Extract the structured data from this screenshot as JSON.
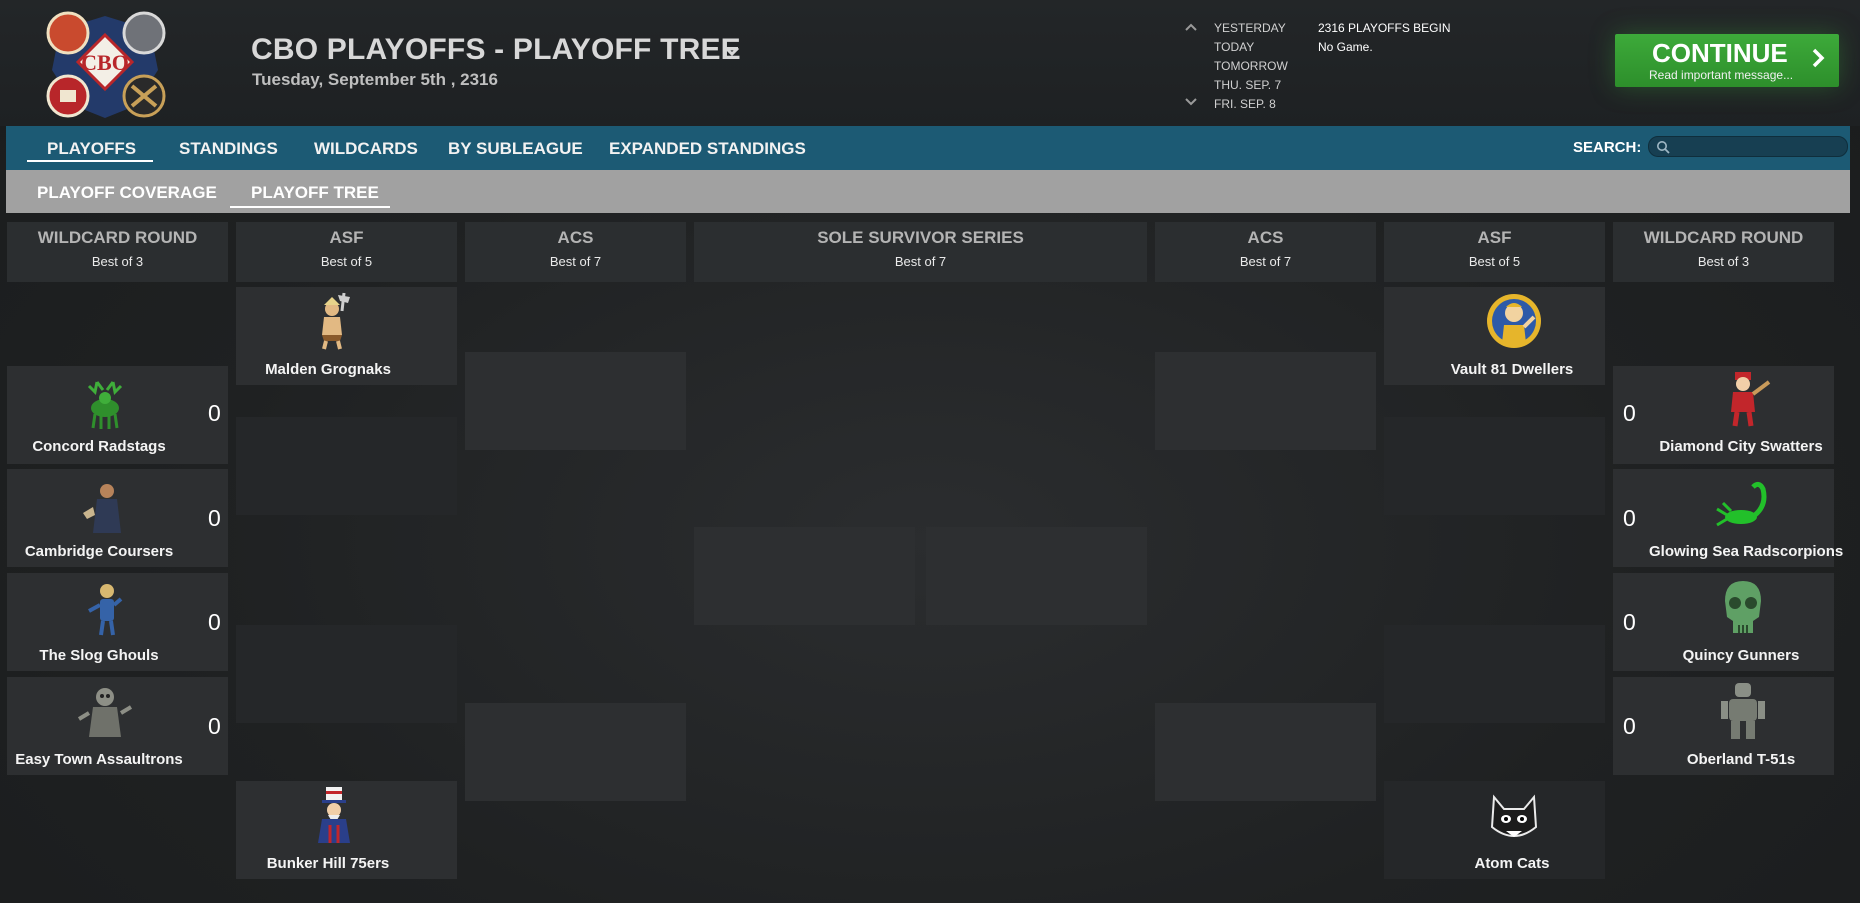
{
  "header": {
    "title": "CBO PLAYOFFS - PLAYOFF TREE",
    "date": "Tuesday, September 5th , 2316",
    "logo_text": "CBO"
  },
  "schedule": {
    "days": [
      {
        "label": "YESTERDAY",
        "value": "2316 PLAYOFFS BEGIN"
      },
      {
        "label": "TODAY",
        "value": "No Game."
      },
      {
        "label": "TOMORROW",
        "value": ""
      },
      {
        "label": "THU. SEP. 7",
        "value": ""
      },
      {
        "label": "FRI. SEP. 8",
        "value": ""
      }
    ]
  },
  "continue": {
    "label": "CONTINUE",
    "sub": "Read important message...",
    "color": "#34a032"
  },
  "nav": {
    "items": [
      "PLAYOFFS",
      "STANDINGS",
      "WILDCARDS",
      "BY SUBLEAGUE",
      "EXPANDED STANDINGS"
    ],
    "active": "PLAYOFFS",
    "search_label": "SEARCH:",
    "search_value": "",
    "color": "#1c5a74"
  },
  "subnav": {
    "items": [
      "PLAYOFF COVERAGE",
      "PLAYOFF TREE"
    ],
    "active": "PLAYOFF TREE"
  },
  "columns": [
    {
      "title": "WILDCARD ROUND",
      "sub": "Best of 3"
    },
    {
      "title": "ASF",
      "sub": "Best of 5"
    },
    {
      "title": "ACS",
      "sub": "Best of 7"
    },
    {
      "title": "SOLE SURVIVOR SERIES",
      "sub": "Best of 7"
    },
    {
      "title": "ACS",
      "sub": "Best of 7"
    },
    {
      "title": "ASF",
      "sub": "Best of 5"
    },
    {
      "title": "WILDCARD ROUND",
      "sub": "Best of 3"
    }
  ],
  "teams": {
    "left_wildcard": [
      {
        "name": "Concord Radstags",
        "score": "0",
        "icon": "stag-icon"
      },
      {
        "name": "Cambridge Coursers",
        "score": "0",
        "icon": "courser-icon"
      },
      {
        "name": "The Slog Ghouls",
        "score": "0",
        "icon": "ghoul-icon"
      },
      {
        "name": "Easy Town Assaultrons",
        "score": "0",
        "icon": "assaultron-icon"
      }
    ],
    "right_wildcard": [
      {
        "name": "Diamond City Swatters",
        "score": "0",
        "icon": "swatter-icon"
      },
      {
        "name": "Glowing Sea Radscorpions",
        "score": "0",
        "icon": "radscorpion-icon"
      },
      {
        "name": "Quincy Gunners",
        "score": "0",
        "icon": "skull-icon"
      },
      {
        "name": "Oberland T-51s",
        "score": "0",
        "icon": "power-armor-icon"
      }
    ],
    "left_asf": [
      {
        "name": "Malden Grognaks",
        "icon": "barbarian-icon"
      },
      {
        "name": "Bunker Hill 75ers",
        "icon": "uncle-sam-icon"
      }
    ],
    "right_asf": [
      {
        "name": "Vault 81 Dwellers",
        "icon": "vault-boy-icon"
      },
      {
        "name": "Atom Cats",
        "icon": "cat-icon"
      }
    ]
  }
}
